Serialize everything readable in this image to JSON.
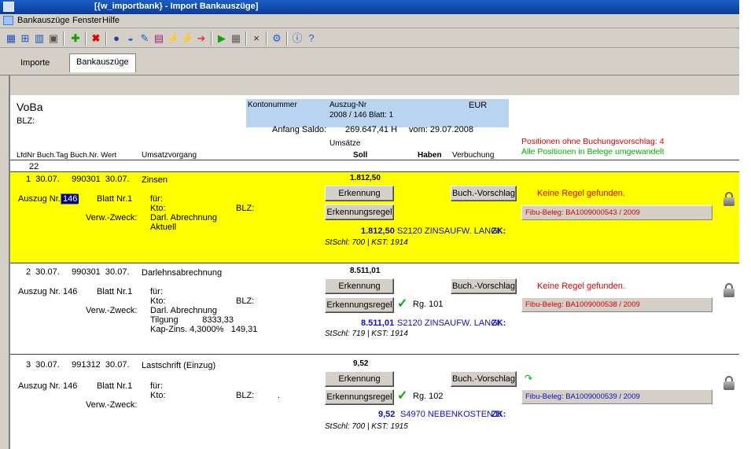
{
  "window": {
    "title": "[{w_importbank} - Import Bankauszüge]"
  },
  "menu": {
    "items": [
      "Bankauszüge",
      "Fenster",
      "Hilfe"
    ]
  },
  "tabs": [
    "Importe",
    "Bankauszüge"
  ],
  "header": {
    "bank_name": "VoBa",
    "blz_label": "BLZ:",
    "kontonummer_label": "Kontonummer",
    "auszug_nr_label": "Auszug-Nr",
    "auszug_value": "2008 / 146  Blatt: 1",
    "currency": "EUR",
    "anfang_saldo_label": "Anfang Saldo:",
    "anfang_saldo_value": "269.647,41  H",
    "vom_label": "vom: 29.07.2008",
    "umsaetze_label": "Umsätze",
    "positions_without": "Positionen ohne Buchungsvorschlag: 4",
    "all_converted": "Alle Positionen in Belege umgewandelt",
    "columns": {
      "lfdnr": "LfdNr",
      "buchtag": "Buch.Tag",
      "buchnr": "Buch.Nr.",
      "wert": "Wert",
      "umsatzvorgang": "Umsatzvorgang",
      "soll": "Soll",
      "haben": "Haben",
      "verbuchung": "Verbuchung"
    },
    "count": "22"
  },
  "labels": {
    "auszug_nr": "Auszug Nr.",
    "blatt": "Blatt Nr.1",
    "fuer": "für:",
    "kto": "Kto:",
    "verw_zweck": "Verw.-Zweck:",
    "blz": "BLZ:",
    "erkennung": "Erkennung",
    "erkennungsregel": "Erkennungsregel",
    "buch_vorschlag": "Buch.-Vorschlag"
  },
  "entries": [
    {
      "header": "1  30.07.     990301  30.07.",
      "vorgang": "Zinsen",
      "amount": "1.812,50",
      "auszug_nr": "146",
      "verw_lines": [
        "Darl. Abrechnung",
        "Aktuell"
      ],
      "regel": "",
      "posting_amount": "1.812,50",
      "posting_text": "S2120 ZINSAUFW. LANGI",
      "zk": "ZK:",
      "stschl": "StSchl: 700 | KST: 1914",
      "status": "Keine Regel gefunden.",
      "fibu": "Fibu-Beleg: BA1009000543 / 2009",
      "highlight": "#ffff00"
    },
    {
      "header": "2  30.07.     990301  30.07.",
      "vorgang": "Darlehnsabrechnung",
      "amount": "8.511,01",
      "auszug_nr": "146",
      "verw_lines": [
        "Darl. Abrechnung",
        "Tilgung          8333,33",
        "Kap-Zins. 4,3000%   149,31"
      ],
      "regel": "Rg. 101",
      "posting_amount": "8.511,01",
      "posting_text": "S2120 ZINSAUFW. LANGI",
      "zk": "ZK:",
      "stschl": "StSchl: 719 | KST: 1914",
      "status": "Keine Regel gefunden.",
      "fibu": "Fibu-Beleg: BA1009000538 / 2009",
      "highlight": "#ffffff"
    },
    {
      "header": "3  30.07.     991312  30.07.",
      "vorgang": "Lastschrift (Einzug)",
      "amount": "9,52",
      "auszug_nr": "146",
      "verw_lines": [],
      "regel": "Rg. 102",
      "posting_amount": "9,52",
      "posting_text": "S4970 NEBENKOSTEN D",
      "zk": "ZK:",
      "stschl": "StSchl: 700 | KST: 1915",
      "status": "",
      "fibu": "Fibu-Beleg: BA1009000539 / 2009",
      "highlight": "#ffffff"
    }
  ],
  "blz_dot": "."
}
